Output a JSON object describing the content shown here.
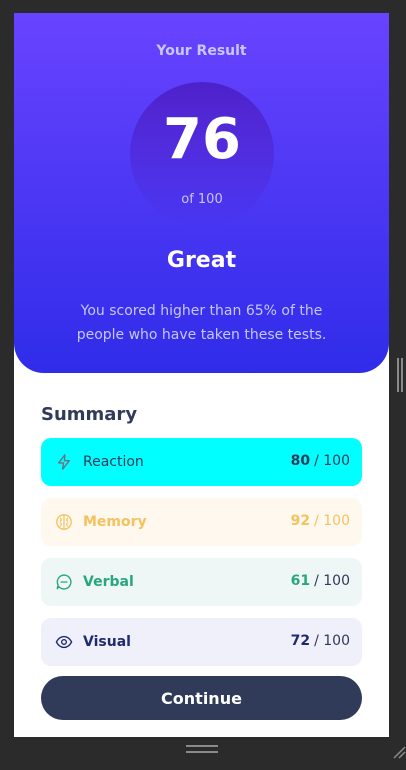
{
  "result": {
    "heading": "Your Result",
    "score": "76",
    "max": "of 100",
    "grade": "Great",
    "description": "You scored higher than 65% of the people who have taken these tests."
  },
  "summary": {
    "title": "Summary",
    "items": [
      {
        "label": "Reaction",
        "score": "80",
        "max": "/ 100",
        "icon": "lightning-icon",
        "color": "#00ffff"
      },
      {
        "label": "Memory",
        "score": "92",
        "max": "/ 100",
        "icon": "brain-icon",
        "color": "#f4c25e"
      },
      {
        "label": "Verbal",
        "score": "61",
        "max": "/ 100",
        "icon": "chat-bubble-icon",
        "color": "#26a77e"
      },
      {
        "label": "Visual",
        "score": "72",
        "max": "/ 100",
        "icon": "eye-icon",
        "color": "#1f2a70"
      }
    ]
  },
  "actions": {
    "continue_label": "Continue"
  },
  "colors": {
    "gradient_top": "#6943ff",
    "gradient_bottom": "#2f2ce9",
    "dark_navy": "#303b59",
    "page_background": "#2b2b2b"
  }
}
